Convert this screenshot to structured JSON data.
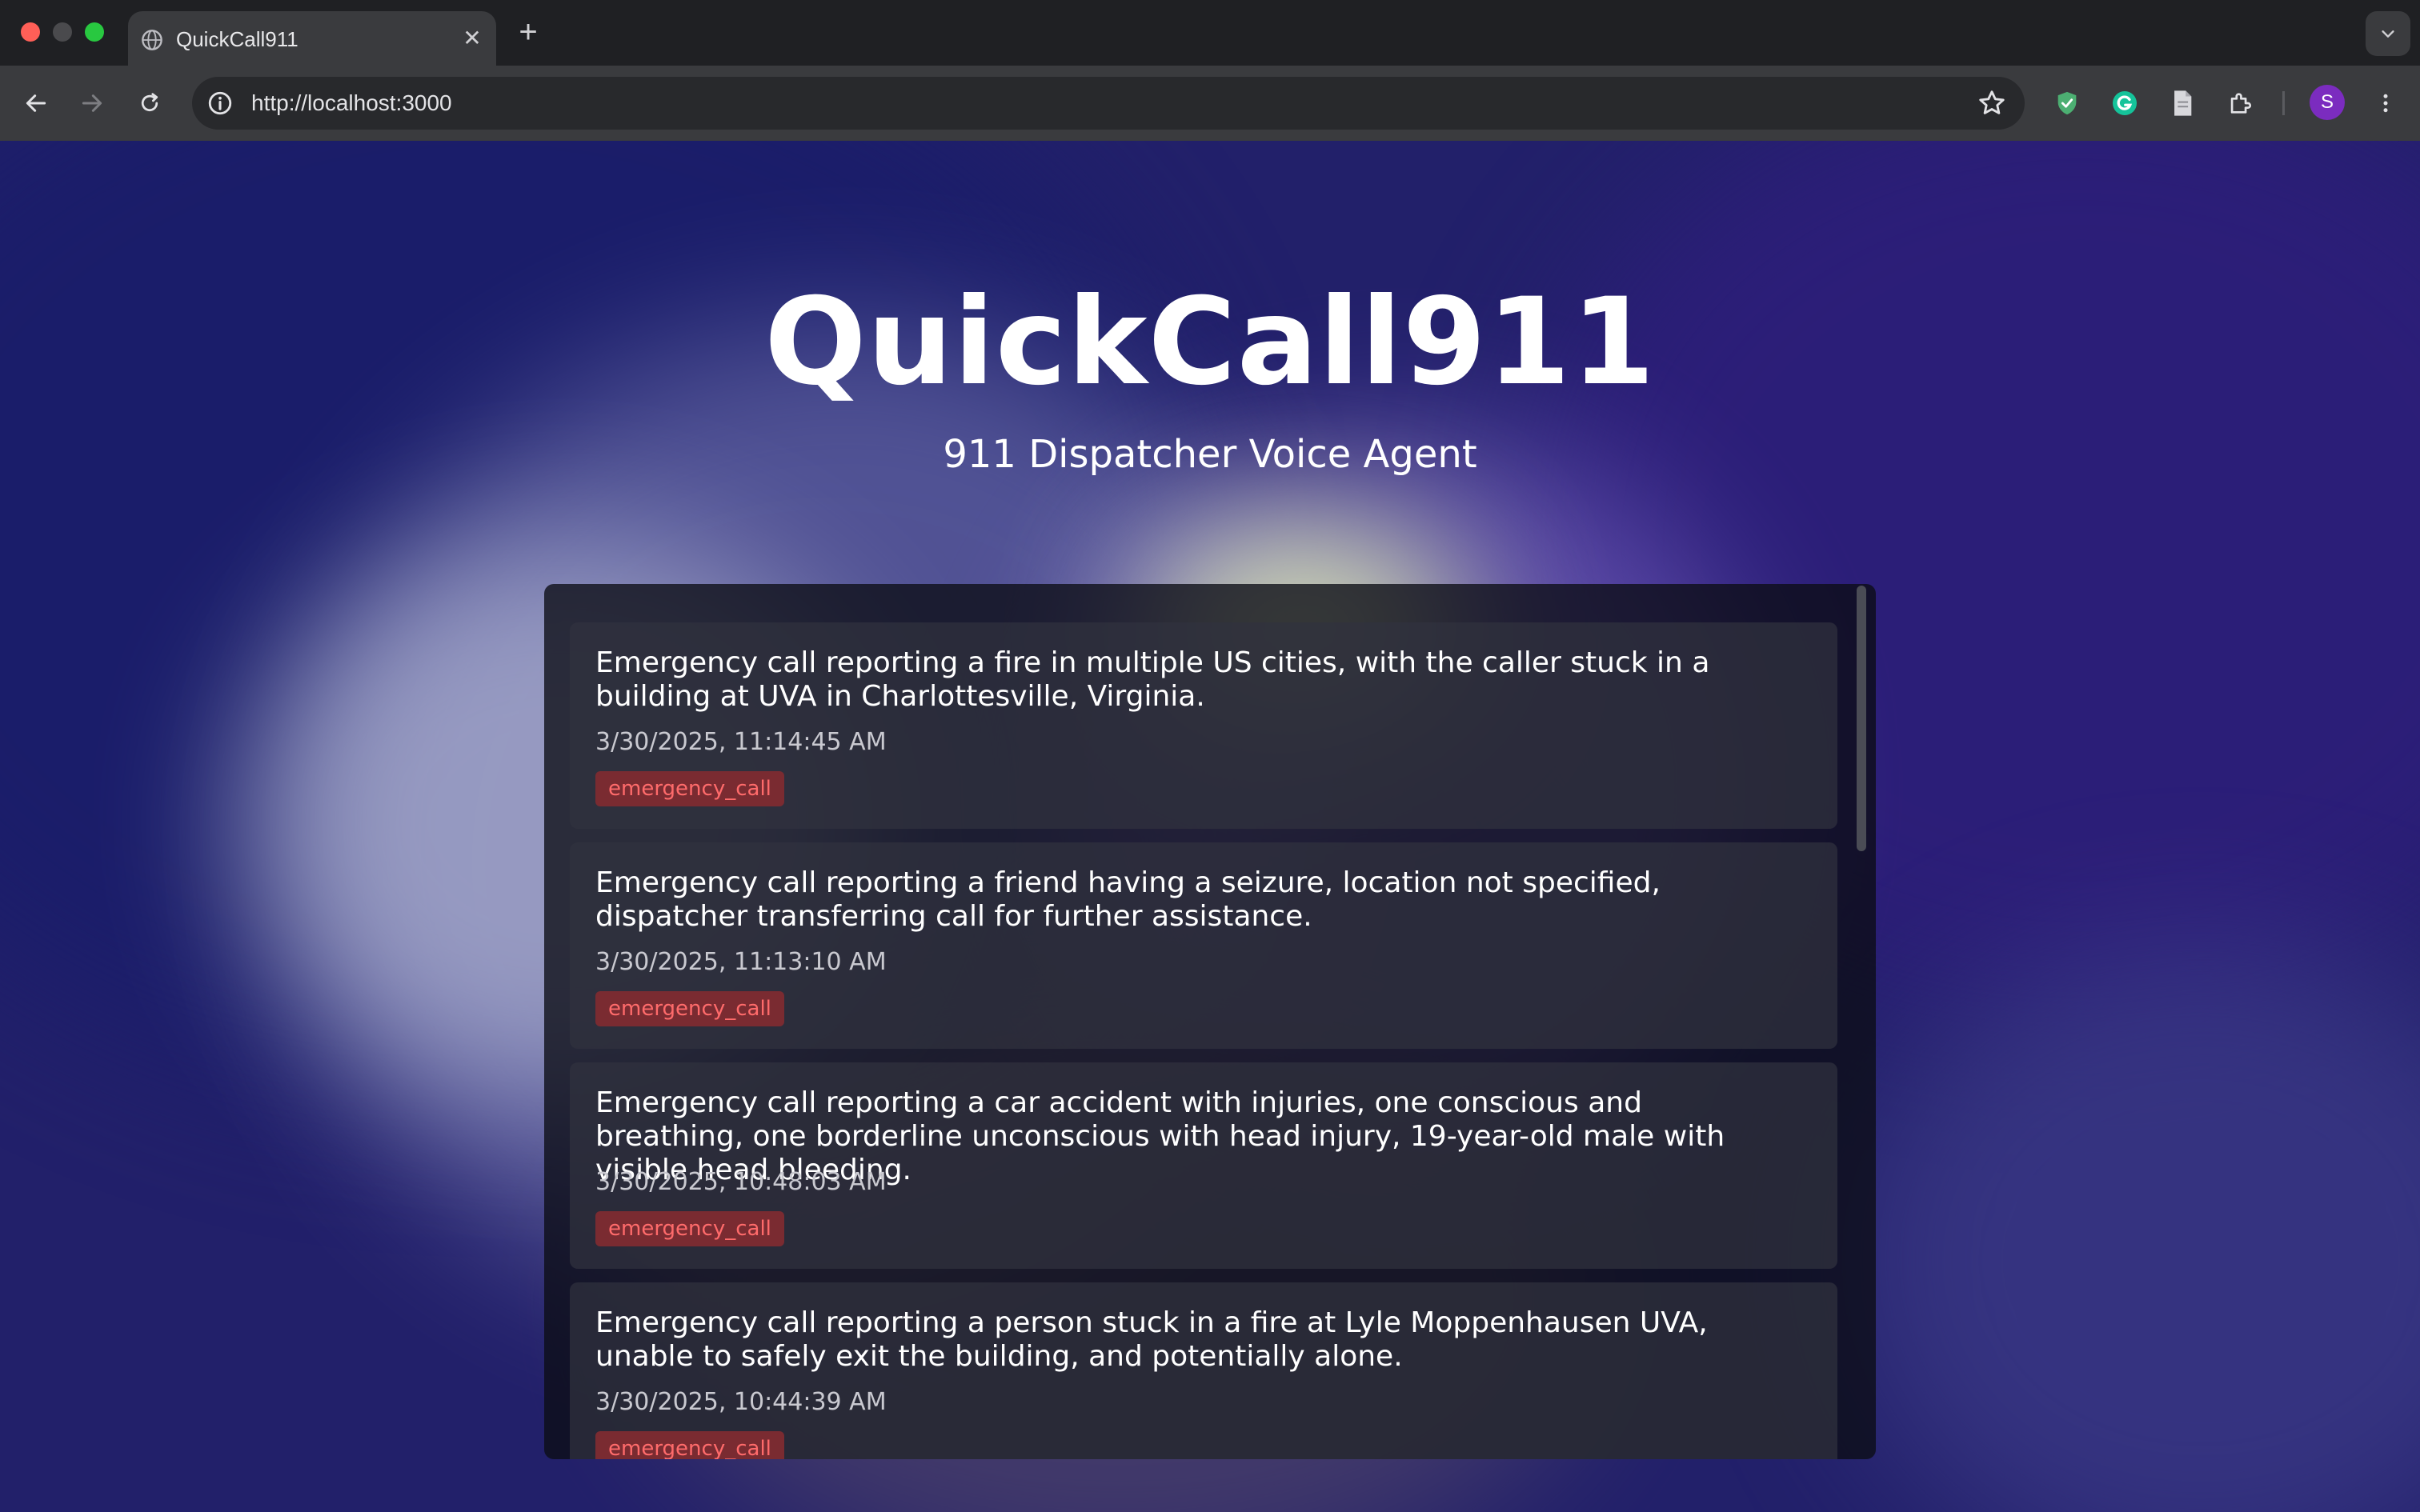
{
  "browser": {
    "tab_title": "QuickCall911",
    "url": "http://localhost:3000",
    "profile_initial": "S",
    "new_tab_symbol": "+",
    "close_symbol": "✕"
  },
  "page": {
    "title": "QuickCall911",
    "subtitle": "911 Dispatcher Voice Agent"
  },
  "calls": [
    {
      "summary": "Emergency call reporting a fire in multiple US cities, with the caller stuck in a building at UVA in Charlottesville, Virginia.",
      "timestamp": "3/30/2025, 11:14:45 AM",
      "tag": "emergency_call"
    },
    {
      "summary": "Emergency call reporting a friend having a seizure, location not specified, dispatcher transferring call for further assistance.",
      "timestamp": "3/30/2025, 11:13:10 AM",
      "tag": "emergency_call"
    },
    {
      "summary": "Emergency call reporting a car accident with injuries, one conscious and breathing, one borderline unconscious with head injury, 19-year-old male with visible head bleeding.",
      "timestamp": "3/30/2025, 10:48:03 AM",
      "tag": "emergency_call"
    },
    {
      "summary": "Emergency call reporting a person stuck in a fire at Lyle Moppenhausen UVA, unable to safely exit the building, and potentially alone.",
      "timestamp": "3/30/2025, 10:44:39 AM",
      "tag": "emergency_call"
    }
  ],
  "colors": {
    "tag_background": "#7a2b31",
    "tag_text": "#ff6b6b",
    "avatar": "#7b2cbf"
  }
}
